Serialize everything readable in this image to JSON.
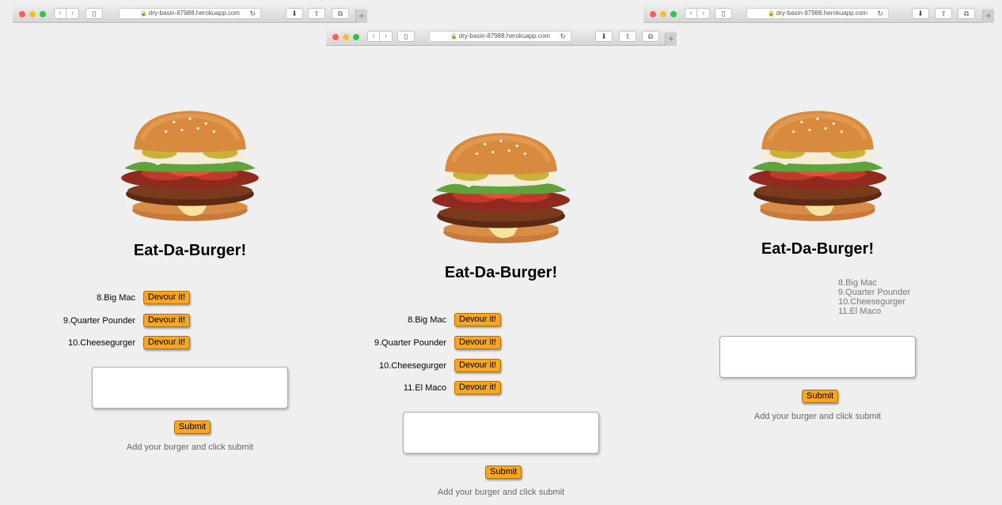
{
  "browser": {
    "url": "dry-basin-87988.herokuapp.com",
    "download_icon": "download-icon",
    "share_icon": "share-icon",
    "tabs_icon": "tabs-icon",
    "new_tab_label": "+"
  },
  "app": {
    "title": "Eat-Da-Burger!",
    "submit_label": "Submit",
    "hint": "Add your burger and click submit",
    "devour_label": "Devour it!"
  },
  "panel_left": {
    "items": [
      "8.Big Mac",
      "9.Quarter Pounder",
      "10.Cheesegurger"
    ]
  },
  "panel_center": {
    "items": [
      "8.Big Mac",
      "9.Quarter Pounder",
      "10.Cheesegurger",
      "11.El Maco"
    ]
  },
  "panel_right": {
    "devoured": [
      "8.Big Mac",
      "9.Quarter Pounder",
      "10.Cheesegurger",
      "11.El Maco"
    ]
  },
  "colors": {
    "button": "#f5a623",
    "background": "#efefef"
  }
}
